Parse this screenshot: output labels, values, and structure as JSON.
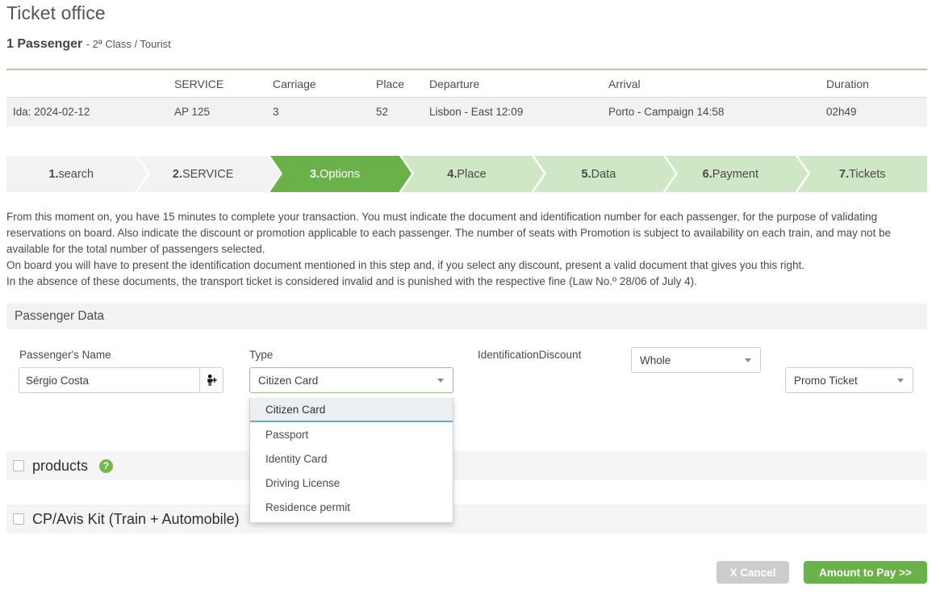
{
  "header": {
    "title": "Ticket office",
    "passenger_count": "1 Passenger",
    "class_info": "- 2ª Class / Tourist"
  },
  "journey_table": {
    "columns": [
      "",
      "SERVICE",
      "Carriage",
      "Place",
      "Departure",
      "Arrival",
      "Duration"
    ],
    "rows": [
      {
        "date": "Ida: 2024-02-12",
        "service": "AP 125",
        "carriage": "3",
        "place": "52",
        "departure": "Lisbon - East 12:09",
        "arrival": "Porto - Campaign 14:58",
        "duration": "02h49"
      }
    ]
  },
  "steps": [
    {
      "num": "1.",
      "label": "search",
      "state": "done"
    },
    {
      "num": "2.",
      "label": "SERVICE",
      "state": "done"
    },
    {
      "num": "3.",
      "label": "Options",
      "state": "active"
    },
    {
      "num": "4.",
      "label": "Place",
      "state": "todo"
    },
    {
      "num": "5.",
      "label": "Data",
      "state": "todo"
    },
    {
      "num": "6.",
      "label": "Payment",
      "state": "todo"
    },
    {
      "num": "7.",
      "label": "Tickets",
      "state": "todo"
    }
  ],
  "info": {
    "line1": "From this moment on, you have 15 minutes to complete your transaction. You must indicate the document and identification number for each passenger, for the purpose of validating reservations on board. Also indicate the discount or promotion applicable to each passenger. The number of seats with Promotion is subject to availability on each train, and may not be available for the total number of passengers selected.",
    "line2": "On board you will have to present the identification document mentioned in this step and, if you select any discount, present a valid document that gives you this right.",
    "line3": "In the absence of these documents, the transport ticket is considered invalid and is punished with the respective fine (Law No.º 28/06 of July 4)."
  },
  "passenger_data": {
    "section_title": "Passenger Data",
    "labels": {
      "name": "Passenger's Name",
      "type": "Type",
      "identification_discount": "IdentificationDiscount"
    },
    "name_value": "Sérgio Costa",
    "name_placeholder": "",
    "add_passenger_icon": "person-add-icon",
    "type_select": {
      "value": "Citizen Card",
      "open": true,
      "options": [
        "Citizen Card",
        "Passport",
        "Identity Card",
        "Driving License",
        "Residence permit"
      ],
      "selected_index": 0
    },
    "discount_select": {
      "value": "Whole"
    },
    "promo_select": {
      "value": "Promo Ticket"
    }
  },
  "extras": [
    {
      "label": "products",
      "checked": false,
      "has_help": true
    },
    {
      "label": "CP/Avis Kit (Train + Automobile)",
      "checked": false,
      "has_help": false
    }
  ],
  "footer": {
    "cancel_label": "X Cancel",
    "pay_label": "Amount to Pay >>"
  },
  "colors": {
    "accent_green": "#6ab14a",
    "step_todo_green": "#cfe7c4",
    "step_done_grey": "#f2f2f2",
    "panel_grey": "#f2f2f2",
    "cancel_grey": "#cccccc",
    "dropdown_selected": "#eceff1",
    "dropdown_selected_border": "#74a7cf",
    "help_icon_green": "#74b94a",
    "table_top_border": "#b6c9a2"
  }
}
